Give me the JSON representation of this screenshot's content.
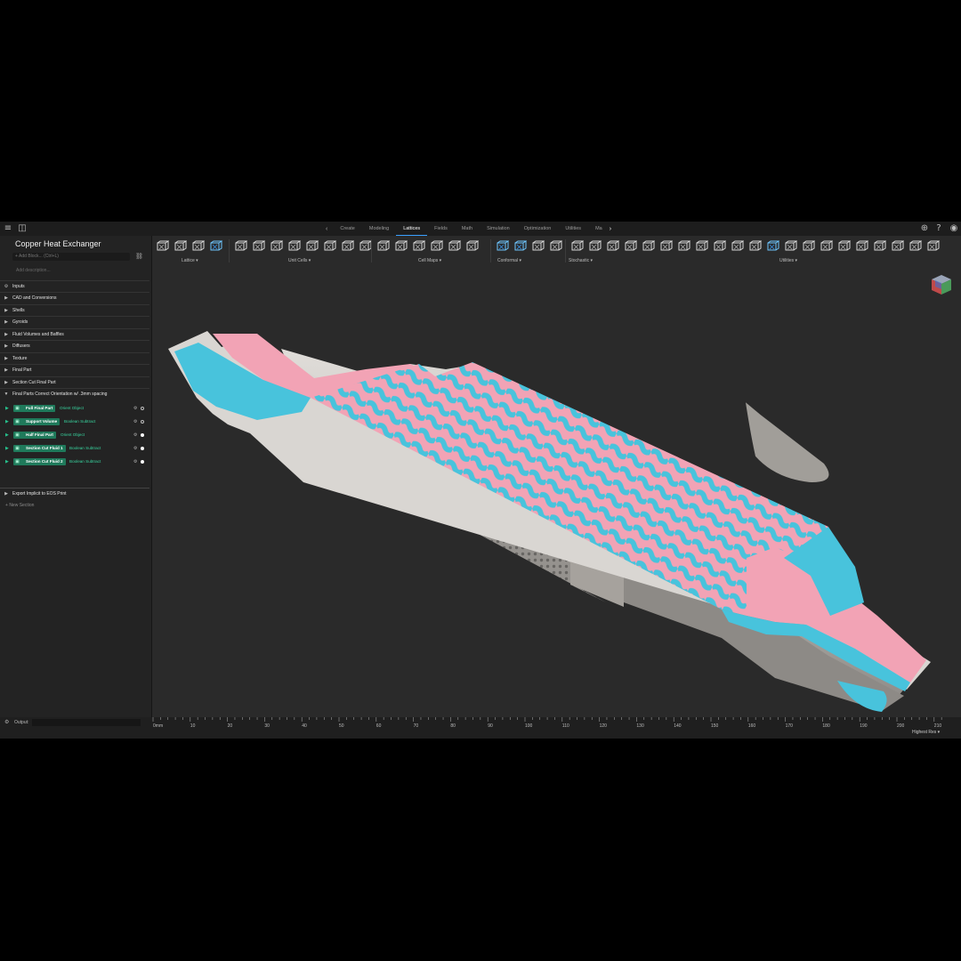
{
  "window": {
    "tabs": [
      "Create",
      "Modeling",
      "Lattices",
      "Fields",
      "Math",
      "Simulation",
      "Optimization",
      "Utilities",
      "Ma"
    ],
    "active_tab": "Lattices"
  },
  "sidebar": {
    "project_title": "Copper Heat Exchanger",
    "add_block_placeholder": "Add Block... (Ctrl+L)",
    "add_description": "Add description...",
    "inputs_label": "Inputs",
    "sections": [
      {
        "label": "CAD and Conversions"
      },
      {
        "label": "Shells"
      },
      {
        "label": "Gyroids"
      },
      {
        "label": "Fluid Volumes and Baffles"
      },
      {
        "label": "Diffusers"
      },
      {
        "label": "Texture"
      },
      {
        "label": "Final Part"
      },
      {
        "label": "Section Cut Final Part"
      },
      {
        "label": "Final Parts Correct Orientation w/ .3mm spacing"
      }
    ],
    "blocks": [
      {
        "name": "Full Final Part",
        "op": "Orient Object",
        "visible": false
      },
      {
        "name": "Support Volume",
        "op": "Boolean Subtract",
        "visible": false
      },
      {
        "name": "Half Final Part",
        "op": "Orient Object",
        "visible": true
      },
      {
        "name": "Section Cut Fluid 1",
        "op": "Boolean Subtract",
        "visible": true
      },
      {
        "name": "Section Cut Fluid 2",
        "op": "Boolean Subtract",
        "visible": true
      }
    ],
    "export_label": "Export Implicit to EOS Print",
    "new_section": "New Section"
  },
  "toolbar": {
    "groups": [
      "Lattice",
      "Unit Cells",
      "Cell Maps",
      "Conformal",
      "Stochastic",
      "Utilities"
    ]
  },
  "bottom": {
    "output_label": "Output:",
    "ruler_unit": "mm",
    "ruler_ticks": [
      0,
      10,
      20,
      30,
      40,
      50,
      60,
      70,
      80,
      90,
      100,
      110,
      120,
      130,
      140,
      150,
      160,
      170,
      180,
      190,
      200,
      210
    ],
    "resolution": "Highest Res"
  },
  "colors": {
    "fluid_1": "#48c3dc",
    "fluid_2": "#f2a3b5",
    "copper_body": "#c4c1bd",
    "accent": "#1f7a5b"
  }
}
